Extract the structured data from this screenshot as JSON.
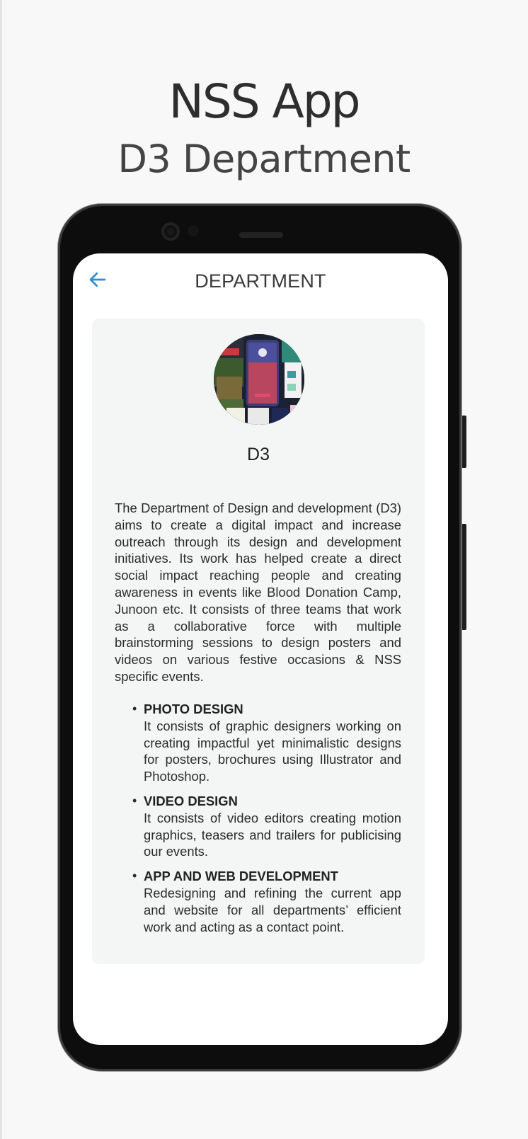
{
  "header": {
    "app_title": "NSS App",
    "subtitle": "D3 Department"
  },
  "screen": {
    "title": "DEPARTMENT",
    "back_icon": "arrow-left-icon",
    "accent_color": "#2f8fce"
  },
  "department": {
    "name": "D3",
    "description": "The Department of Design and development (D3) aims to create a digital impact and increase outreach through its design and development initiatives. Its work has helped create a direct social impact reaching people and creating awareness in events like Blood Donation Camp, Junoon etc. It consists of three teams that work as a collaborative force with multiple brainstorming sessions to design posters and videos on various festive occasions & NSS specific events.",
    "teams": [
      {
        "name": "PHOTO DESIGN",
        "description": "It consists of graphic designers working on creating impactful yet minimalistic designs for posters, brochures using Illustrator and Photoshop."
      },
      {
        "name": "VIDEO DESIGN",
        "description": "It consists of video editors creating motion graphics, teasers and trailers for publicising our events."
      },
      {
        "name": "APP AND WEB DEVELOPMENT",
        "description": "Redesigning and refining the current app and website for all departments’ efficient work and acting as a contact point."
      }
    ]
  }
}
